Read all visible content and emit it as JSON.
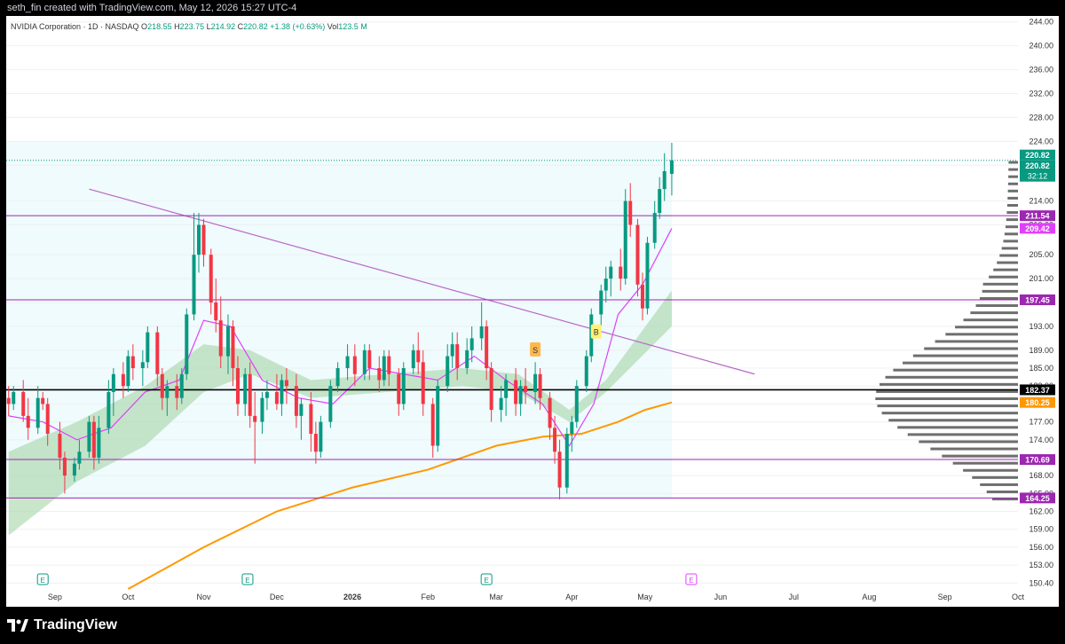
{
  "header": {
    "caption": "seth_fin created with TradingView.com, May 12, 2026 15:27 UTC-4"
  },
  "footer": {
    "brand": "TradingView"
  },
  "chart_data": {
    "type": "candlestick",
    "symbol_line": {
      "name": "NVIDIA Corporation · 1D · NASDAQ",
      "o_label": "O",
      "o_value": "218.55",
      "h_label": "H",
      "h_value": "223.75",
      "l_label": "L",
      "l_value": "214.92",
      "c_label": "C",
      "c_value": "220.82",
      "change": "+1.38 (+0.63%)",
      "vol_label": "Vol",
      "vol_value": "123.5 M"
    },
    "ylim": [
      149,
      245
    ],
    "y_ticks": [
      150,
      153,
      156,
      159,
      162,
      165,
      168,
      171,
      174,
      177,
      180,
      183,
      186,
      189,
      193,
      197,
      201,
      205,
      210,
      214,
      220,
      224,
      228,
      232,
      236,
      240,
      244
    ],
    "y_tick_labels": [
      "150.40",
      "153.00",
      "156.00",
      "159.00",
      "162.00",
      "165.00",
      "168.00",
      "171.00",
      "174.00",
      "177.00",
      "180.25",
      "183.00",
      "185.00",
      "189.00",
      "193.00",
      "197.00",
      "201.00",
      "205.00",
      "210.00",
      "214.00",
      "220.00",
      "224.00",
      "228.00",
      "232.00",
      "236.00",
      "240.00",
      "244.00"
    ],
    "x_labels": [
      {
        "text": "Sep",
        "date": "2025-09-01"
      },
      {
        "text": "Oct",
        "date": "2025-10-01"
      },
      {
        "text": "Nov",
        "date": "2025-11-01"
      },
      {
        "text": "Dec",
        "date": "2025-12-01"
      },
      {
        "text": "2026",
        "date": "2026-01-01"
      },
      {
        "text": "Feb",
        "date": "2026-02-01"
      },
      {
        "text": "Mar",
        "date": "2026-03-01"
      },
      {
        "text": "Apr",
        "date": "2026-04-01"
      },
      {
        "text": "May",
        "date": "2026-05-01"
      },
      {
        "text": "Jun",
        "date": "2026-06-01"
      },
      {
        "text": "Jul",
        "date": "2026-07-01"
      },
      {
        "text": "Aug",
        "date": "2026-08-01"
      },
      {
        "text": "Sep",
        "date": "2026-09-01"
      },
      {
        "text": "Oct",
        "date": "2026-10-01"
      }
    ],
    "x_range": [
      "2025-08-12",
      "2026-10-01"
    ],
    "candles": [
      {
        "d": "2025-08-13",
        "o": 181,
        "h": 183,
        "l": 178,
        "c": 180
      },
      {
        "d": "2025-08-15",
        "o": 180,
        "h": 183,
        "l": 179,
        "c": 182
      },
      {
        "d": "2025-08-19",
        "o": 182,
        "h": 184,
        "l": 177,
        "c": 178
      },
      {
        "d": "2025-08-21",
        "o": 178,
        "h": 181,
        "l": 174,
        "c": 176
      },
      {
        "d": "2025-08-25",
        "o": 176,
        "h": 183,
        "l": 175,
        "c": 181
      },
      {
        "d": "2025-08-27",
        "o": 181,
        "h": 182,
        "l": 179,
        "c": 180
      },
      {
        "d": "2025-08-29",
        "o": 180,
        "h": 181,
        "l": 173,
        "c": 175
      },
      {
        "d": "2025-09-03",
        "o": 175,
        "h": 177,
        "l": 169,
        "c": 171
      },
      {
        "d": "2025-09-05",
        "o": 171,
        "h": 172,
        "l": 165,
        "c": 168
      },
      {
        "d": "2025-09-09",
        "o": 168,
        "h": 171,
        "l": 167,
        "c": 170
      },
      {
        "d": "2025-09-11",
        "o": 170,
        "h": 174,
        "l": 169,
        "c": 172
      },
      {
        "d": "2025-09-15",
        "o": 172,
        "h": 178,
        "l": 171,
        "c": 177
      },
      {
        "d": "2025-09-17",
        "o": 177,
        "h": 178,
        "l": 169,
        "c": 171
      },
      {
        "d": "2025-09-19",
        "o": 171,
        "h": 178,
        "l": 170,
        "c": 176
      },
      {
        "d": "2025-09-23",
        "o": 176,
        "h": 184,
        "l": 175,
        "c": 182
      },
      {
        "d": "2025-09-25",
        "o": 182,
        "h": 186,
        "l": 178,
        "c": 185
      },
      {
        "d": "2025-09-29",
        "o": 185,
        "h": 187,
        "l": 181,
        "c": 183
      },
      {
        "d": "2025-10-01",
        "o": 183,
        "h": 189,
        "l": 182,
        "c": 188
      },
      {
        "d": "2025-10-03",
        "o": 188,
        "h": 190,
        "l": 184,
        "c": 186
      },
      {
        "d": "2025-10-07",
        "o": 186,
        "h": 189,
        "l": 183,
        "c": 187
      },
      {
        "d": "2025-10-09",
        "o": 187,
        "h": 193,
        "l": 186,
        "c": 192
      },
      {
        "d": "2025-10-13",
        "o": 192,
        "h": 193,
        "l": 183,
        "c": 185
      },
      {
        "d": "2025-10-15",
        "o": 185,
        "h": 186,
        "l": 179,
        "c": 181
      },
      {
        "d": "2025-10-17",
        "o": 181,
        "h": 184,
        "l": 178,
        "c": 183
      },
      {
        "d": "2025-10-21",
        "o": 183,
        "h": 185,
        "l": 179,
        "c": 181
      },
      {
        "d": "2025-10-23",
        "o": 181,
        "h": 186,
        "l": 180,
        "c": 185
      },
      {
        "d": "2025-10-25",
        "o": 185,
        "h": 196,
        "l": 184,
        "c": 195
      },
      {
        "d": "2025-10-28",
        "o": 195,
        "h": 212,
        "l": 194,
        "c": 205
      },
      {
        "d": "2025-10-30",
        "o": 205,
        "h": 212,
        "l": 202,
        "c": 210
      },
      {
        "d": "2025-11-01",
        "o": 210,
        "h": 211,
        "l": 203,
        "c": 205
      },
      {
        "d": "2025-11-04",
        "o": 205,
        "h": 206,
        "l": 195,
        "c": 197
      },
      {
        "d": "2025-11-06",
        "o": 197,
        "h": 201,
        "l": 192,
        "c": 194
      },
      {
        "d": "2025-11-08",
        "o": 194,
        "h": 198,
        "l": 186,
        "c": 188
      },
      {
        "d": "2025-11-11",
        "o": 188,
        "h": 195,
        "l": 185,
        "c": 193
      },
      {
        "d": "2025-11-13",
        "o": 193,
        "h": 194,
        "l": 183,
        "c": 186
      },
      {
        "d": "2025-11-15",
        "o": 186,
        "h": 188,
        "l": 178,
        "c": 180
      },
      {
        "d": "2025-11-18",
        "o": 180,
        "h": 186,
        "l": 178,
        "c": 185
      },
      {
        "d": "2025-11-20",
        "o": 185,
        "h": 187,
        "l": 176,
        "c": 178
      },
      {
        "d": "2025-11-22",
        "o": 178,
        "h": 182,
        "l": 170,
        "c": 177
      },
      {
        "d": "2025-11-25",
        "o": 177,
        "h": 182,
        "l": 175,
        "c": 181
      },
      {
        "d": "2025-11-27",
        "o": 181,
        "h": 184,
        "l": 179,
        "c": 182
      },
      {
        "d": "2025-12-01",
        "o": 182,
        "h": 185,
        "l": 179,
        "c": 180
      },
      {
        "d": "2025-12-03",
        "o": 180,
        "h": 185,
        "l": 178,
        "c": 184
      },
      {
        "d": "2025-12-05",
        "o": 184,
        "h": 186,
        "l": 180,
        "c": 183
      },
      {
        "d": "2025-12-09",
        "o": 183,
        "h": 185,
        "l": 176,
        "c": 178
      },
      {
        "d": "2025-12-11",
        "o": 178,
        "h": 181,
        "l": 174,
        "c": 180
      },
      {
        "d": "2025-12-15",
        "o": 180,
        "h": 182,
        "l": 172,
        "c": 175
      },
      {
        "d": "2025-12-17",
        "o": 175,
        "h": 177,
        "l": 170,
        "c": 172
      },
      {
        "d": "2025-12-19",
        "o": 172,
        "h": 178,
        "l": 171,
        "c": 177
      },
      {
        "d": "2025-12-23",
        "o": 177,
        "h": 184,
        "l": 176,
        "c": 183
      },
      {
        "d": "2025-12-26",
        "o": 183,
        "h": 187,
        "l": 182,
        "c": 186
      },
      {
        "d": "2025-12-30",
        "o": 186,
        "h": 190,
        "l": 184,
        "c": 188
      },
      {
        "d": "2026-01-02",
        "o": 188,
        "h": 190,
        "l": 183,
        "c": 185
      },
      {
        "d": "2026-01-06",
        "o": 185,
        "h": 190,
        "l": 184,
        "c": 189
      },
      {
        "d": "2026-01-08",
        "o": 189,
        "h": 190,
        "l": 184,
        "c": 186
      },
      {
        "d": "2026-01-12",
        "o": 186,
        "h": 188,
        "l": 182,
        "c": 184
      },
      {
        "d": "2026-01-14",
        "o": 184,
        "h": 189,
        "l": 183,
        "c": 188
      },
      {
        "d": "2026-01-16",
        "o": 188,
        "h": 189,
        "l": 183,
        "c": 185
      },
      {
        "d": "2026-01-20",
        "o": 185,
        "h": 186,
        "l": 178,
        "c": 180
      },
      {
        "d": "2026-01-22",
        "o": 180,
        "h": 187,
        "l": 179,
        "c": 186
      },
      {
        "d": "2026-01-26",
        "o": 186,
        "h": 190,
        "l": 185,
        "c": 189
      },
      {
        "d": "2026-01-28",
        "o": 189,
        "h": 192,
        "l": 185,
        "c": 187
      },
      {
        "d": "2026-01-30",
        "o": 187,
        "h": 189,
        "l": 178,
        "c": 180
      },
      {
        "d": "2026-02-03",
        "o": 180,
        "h": 181,
        "l": 171,
        "c": 173
      },
      {
        "d": "2026-02-05",
        "o": 173,
        "h": 184,
        "l": 172,
        "c": 183
      },
      {
        "d": "2026-02-09",
        "o": 183,
        "h": 190,
        "l": 182,
        "c": 188
      },
      {
        "d": "2026-02-11",
        "o": 188,
        "h": 192,
        "l": 186,
        "c": 190
      },
      {
        "d": "2026-02-13",
        "o": 190,
        "h": 192,
        "l": 184,
        "c": 186
      },
      {
        "d": "2026-02-17",
        "o": 186,
        "h": 191,
        "l": 185,
        "c": 189
      },
      {
        "d": "2026-02-19",
        "o": 189,
        "h": 193,
        "l": 187,
        "c": 191
      },
      {
        "d": "2026-02-23",
        "o": 191,
        "h": 197,
        "l": 189,
        "c": 193
      },
      {
        "d": "2026-02-25",
        "o": 193,
        "h": 194,
        "l": 184,
        "c": 186
      },
      {
        "d": "2026-02-27",
        "o": 186,
        "h": 187,
        "l": 177,
        "c": 179
      },
      {
        "d": "2026-03-03",
        "o": 179,
        "h": 183,
        "l": 177,
        "c": 181
      },
      {
        "d": "2026-03-05",
        "o": 181,
        "h": 185,
        "l": 178,
        "c": 184
      },
      {
        "d": "2026-03-09",
        "o": 184,
        "h": 186,
        "l": 178,
        "c": 180
      },
      {
        "d": "2026-03-11",
        "o": 180,
        "h": 184,
        "l": 178,
        "c": 183
      },
      {
        "d": "2026-03-13",
        "o": 183,
        "h": 186,
        "l": 180,
        "c": 182
      },
      {
        "d": "2026-03-17",
        "o": 182,
        "h": 187,
        "l": 180,
        "c": 185
      },
      {
        "d": "2026-03-19",
        "o": 185,
        "h": 186,
        "l": 179,
        "c": 181
      },
      {
        "d": "2026-03-23",
        "o": 181,
        "h": 182,
        "l": 174,
        "c": 176
      },
      {
        "d": "2026-03-25",
        "o": 176,
        "h": 178,
        "l": 170,
        "c": 172
      },
      {
        "d": "2026-03-27",
        "o": 172,
        "h": 174,
        "l": 164,
        "c": 166
      },
      {
        "d": "2026-03-30",
        "o": 166,
        "h": 176,
        "l": 165,
        "c": 175
      },
      {
        "d": "2026-04-01",
        "o": 175,
        "h": 178,
        "l": 172,
        "c": 177
      },
      {
        "d": "2026-04-03",
        "o": 177,
        "h": 184,
        "l": 176,
        "c": 183
      },
      {
        "d": "2026-04-07",
        "o": 183,
        "h": 189,
        "l": 182,
        "c": 188
      },
      {
        "d": "2026-04-09",
        "o": 188,
        "h": 196,
        "l": 187,
        "c": 195
      },
      {
        "d": "2026-04-13",
        "o": 195,
        "h": 200,
        "l": 193,
        "c": 199
      },
      {
        "d": "2026-04-15",
        "o": 199,
        "h": 203,
        "l": 197,
        "c": 201
      },
      {
        "d": "2026-04-17",
        "o": 201,
        "h": 204,
        "l": 198,
        "c": 203
      },
      {
        "d": "2026-04-21",
        "o": 203,
        "h": 206,
        "l": 199,
        "c": 201
      },
      {
        "d": "2026-04-23",
        "o": 201,
        "h": 216,
        "l": 200,
        "c": 214
      },
      {
        "d": "2026-04-25",
        "o": 214,
        "h": 217,
        "l": 208,
        "c": 210
      },
      {
        "d": "2026-04-28",
        "o": 210,
        "h": 211,
        "l": 198,
        "c": 200
      },
      {
        "d": "2026-04-30",
        "o": 200,
        "h": 202,
        "l": 194,
        "c": 196
      },
      {
        "d": "2026-05-02",
        "o": 196,
        "h": 208,
        "l": 195,
        "c": 207
      },
      {
        "d": "2026-05-05",
        "o": 207,
        "h": 214,
        "l": 206,
        "c": 212
      },
      {
        "d": "2026-05-07",
        "o": 212,
        "h": 218,
        "l": 211,
        "c": 216
      },
      {
        "d": "2026-05-09",
        "o": 216,
        "h": 222,
        "l": 214,
        "c": 219
      },
      {
        "d": "2026-05-12",
        "o": 218.55,
        "h": 223.75,
        "l": 214.92,
        "c": 220.82
      }
    ],
    "horizontal_levels": [
      {
        "label": "211.54",
        "value": 211.54,
        "color": "#9c27b0"
      },
      {
        "label": "197.45",
        "value": 197.45,
        "color": "#9c27b0"
      },
      {
        "label": "182.37",
        "value": 182.37,
        "color": "#000000"
      },
      {
        "label": "170.69",
        "value": 170.69,
        "color": "#9c27b0"
      },
      {
        "label": "164.25",
        "value": 164.25,
        "color": "#9c27b0"
      }
    ],
    "price_badges": [
      {
        "label": "220.82",
        "value": 220.82,
        "color": "#089981"
      },
      {
        "label": "209.42",
        "value": 209.42,
        "color": "#e040fb"
      },
      {
        "label": "180.25",
        "value": 180.25,
        "color": "#ff9800"
      }
    ],
    "countdown": "32:12",
    "current_price": "220.82",
    "trendline": {
      "start": {
        "d": "2025-09-15",
        "v": 216
      },
      "end": {
        "d": "2026-06-15",
        "v": 185
      },
      "color": "#ba68c8"
    },
    "sma_long": [
      {
        "d": "2025-10-01",
        "v": 149
      },
      {
        "d": "2025-11-01",
        "v": 156
      },
      {
        "d": "2025-12-01",
        "v": 162
      },
      {
        "d": "2026-01-01",
        "v": 166
      },
      {
        "d": "2026-02-01",
        "v": 169
      },
      {
        "d": "2026-03-01",
        "v": 173
      },
      {
        "d": "2026-03-20",
        "v": 174.5
      },
      {
        "d": "2026-04-05",
        "v": 175
      },
      {
        "d": "2026-04-20",
        "v": 177
      },
      {
        "d": "2026-05-01",
        "v": 179
      },
      {
        "d": "2026-05-12",
        "v": 180.25
      }
    ],
    "ema_short": [
      {
        "d": "2025-08-13",
        "v": 178
      },
      {
        "d": "2025-08-27",
        "v": 177
      },
      {
        "d": "2025-09-10",
        "v": 174
      },
      {
        "d": "2025-09-24",
        "v": 176
      },
      {
        "d": "2025-10-08",
        "v": 182
      },
      {
        "d": "2025-10-22",
        "v": 184
      },
      {
        "d": "2025-11-01",
        "v": 194
      },
      {
        "d": "2025-11-12",
        "v": 193
      },
      {
        "d": "2025-11-25",
        "v": 184
      },
      {
        "d": "2025-12-10",
        "v": 181
      },
      {
        "d": "2025-12-24",
        "v": 180
      },
      {
        "d": "2026-01-08",
        "v": 186
      },
      {
        "d": "2026-01-22",
        "v": 185
      },
      {
        "d": "2026-02-05",
        "v": 184
      },
      {
        "d": "2026-02-20",
        "v": 188
      },
      {
        "d": "2026-03-05",
        "v": 184
      },
      {
        "d": "2026-03-20",
        "v": 180
      },
      {
        "d": "2026-03-31",
        "v": 173
      },
      {
        "d": "2026-04-10",
        "v": 180
      },
      {
        "d": "2026-04-20",
        "v": 195
      },
      {
        "d": "2026-04-30",
        "v": 200
      },
      {
        "d": "2026-05-12",
        "v": 209.42
      }
    ],
    "cloud": {
      "upper": [
        {
          "d": "2025-08-13",
          "v": 172
        },
        {
          "d": "2025-09-10",
          "v": 177
        },
        {
          "d": "2025-10-08",
          "v": 183
        },
        {
          "d": "2025-11-01",
          "v": 190
        },
        {
          "d": "2025-11-20",
          "v": 189
        },
        {
          "d": "2025-12-15",
          "v": 184
        },
        {
          "d": "2026-01-15",
          "v": 185
        },
        {
          "d": "2026-02-15",
          "v": 186
        },
        {
          "d": "2026-03-10",
          "v": 185
        },
        {
          "d": "2026-03-31",
          "v": 179
        },
        {
          "d": "2026-04-15",
          "v": 184
        },
        {
          "d": "2026-05-12",
          "v": 199
        }
      ],
      "lower": [
        {
          "d": "2025-08-13",
          "v": 158
        },
        {
          "d": "2025-09-10",
          "v": 167
        },
        {
          "d": "2025-10-08",
          "v": 173
        },
        {
          "d": "2025-11-01",
          "v": 182
        },
        {
          "d": "2025-11-20",
          "v": 185
        },
        {
          "d": "2025-12-15",
          "v": 181
        },
        {
          "d": "2026-01-15",
          "v": 182
        },
        {
          "d": "2026-02-15",
          "v": 183
        },
        {
          "d": "2026-03-10",
          "v": 182
        },
        {
          "d": "2026-03-31",
          "v": 177
        },
        {
          "d": "2026-04-15",
          "v": 182
        },
        {
          "d": "2026-05-12",
          "v": 193
        }
      ]
    },
    "signals": [
      {
        "label": "S",
        "d": "2026-03-17",
        "v": 189,
        "color": "#ffb74d"
      },
      {
        "label": "B",
        "d": "2026-04-11",
        "v": 192,
        "color": "#fff176"
      }
    ],
    "earnings_markers": [
      {
        "label": "E",
        "d": "2025-08-27"
      },
      {
        "label": "E",
        "d": "2025-11-19"
      },
      {
        "label": "E",
        "d": "2026-02-25"
      },
      {
        "label": "E",
        "d": "2026-05-20"
      }
    ],
    "colors": {
      "up": "#089981",
      "down": "#f23645",
      "sma_long": "#ff9800",
      "ema_short": "#e040fb",
      "cloud": "#a5d6a7",
      "grid": "#eef0f3"
    }
  }
}
